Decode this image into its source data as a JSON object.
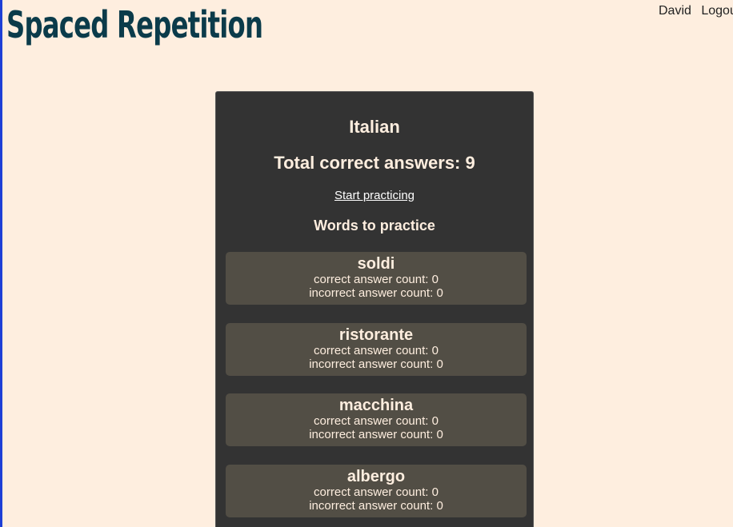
{
  "header": {
    "title": "Spaced Repetition",
    "username": "David",
    "logout_label": "Logout"
  },
  "dashboard": {
    "language": "Italian",
    "total_correct": "Total correct answers: 9",
    "start_label": "Start practicing",
    "words_heading": "Words to practice",
    "words": [
      {
        "original": "soldi",
        "correct": "correct answer count: 0",
        "incorrect": "incorrect answer count: 0"
      },
      {
        "original": "ristorante",
        "correct": "correct answer count: 0",
        "incorrect": "incorrect answer count: 0"
      },
      {
        "original": "macchina",
        "correct": "correct answer count: 0",
        "incorrect": "incorrect answer count: 0"
      },
      {
        "original": "albergo",
        "correct": "correct answer count: 0",
        "incorrect": "incorrect answer count: 0"
      }
    ]
  },
  "colors": {
    "background": "#feeedf",
    "title": "#0b3b4a",
    "panel": "#333333",
    "card": "#524e45",
    "left_border": "#1e3fd6"
  }
}
